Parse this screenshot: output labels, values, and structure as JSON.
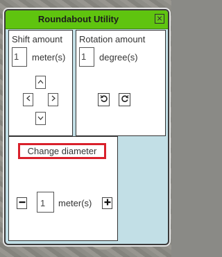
{
  "window": {
    "title": "Roundabout Utility"
  },
  "shift": {
    "label": "Shift amount",
    "value": "1",
    "unit": "meter(s)"
  },
  "rotation": {
    "label": "Rotation amount",
    "value": "1",
    "unit": "degree(s)"
  },
  "diameter": {
    "label": "Change diameter",
    "value": "1",
    "unit": "meter(s)",
    "minus": "−",
    "plus": "+"
  },
  "icons": {
    "up": "chevron-up-icon",
    "down": "chevron-down-icon",
    "left": "chevron-left-icon",
    "right": "chevron-right-icon",
    "rotate_ccw": "rotate-ccw-icon",
    "rotate_cw": "rotate-cw-icon",
    "close": "close-icon"
  },
  "colors": {
    "titlebar": "#5fc40f",
    "window_bg": "#c2dfe6",
    "highlight": "#d9202b"
  }
}
